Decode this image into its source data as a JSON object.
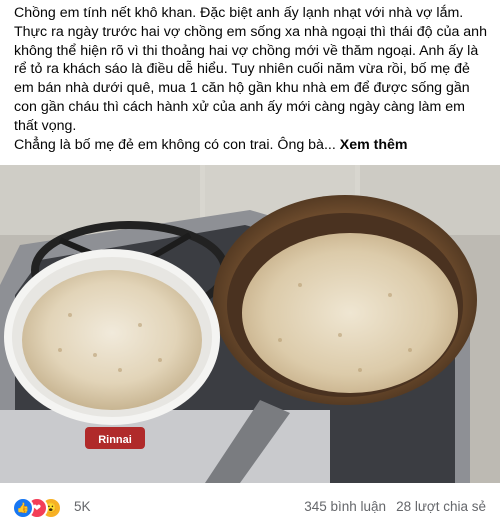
{
  "post": {
    "paragraph_1": "Chồng em tính nết khô khan. Đặc biệt anh ấy lạnh nhạt với nhà vợ lắm. Thực ra ngày trước hai vợ chồng em sống xa nhà ngoại thì thái độ của anh không thể hiện rõ vì thi thoảng hai vợ chồng mới về thăm ngoại. Anh ấy là rể tỏ ra khách sáo là điều dễ hiểu. Tuy nhiên cuối năm vừa rồi, bố mẹ đẻ em bán nhà dưới quê, mua 1 căn hộ gần khu nhà em để được sống gần con gần cháu thì cách hành xử của anh ấy mới càng ngày càng làm em thất vọng.",
    "paragraph_2": "Chẳng là bố mẹ đẻ em không có con trai. Ông bà...",
    "see_more_label": "Xem thêm"
  },
  "photo": {
    "icon": "photo-of-food-on-stove",
    "stove_brand": "Rinnai"
  },
  "footer": {
    "reaction_icons": [
      "like-icon",
      "love-icon",
      "wow-icon"
    ],
    "reaction_count": "5K",
    "comments_label": "345 bình luận",
    "shares_label": "28 lượt chia sẻ"
  },
  "colors": {
    "like": "#1877f2",
    "love": "#f33e58",
    "wow": "#f7b125",
    "secondary_text": "#65676b"
  }
}
